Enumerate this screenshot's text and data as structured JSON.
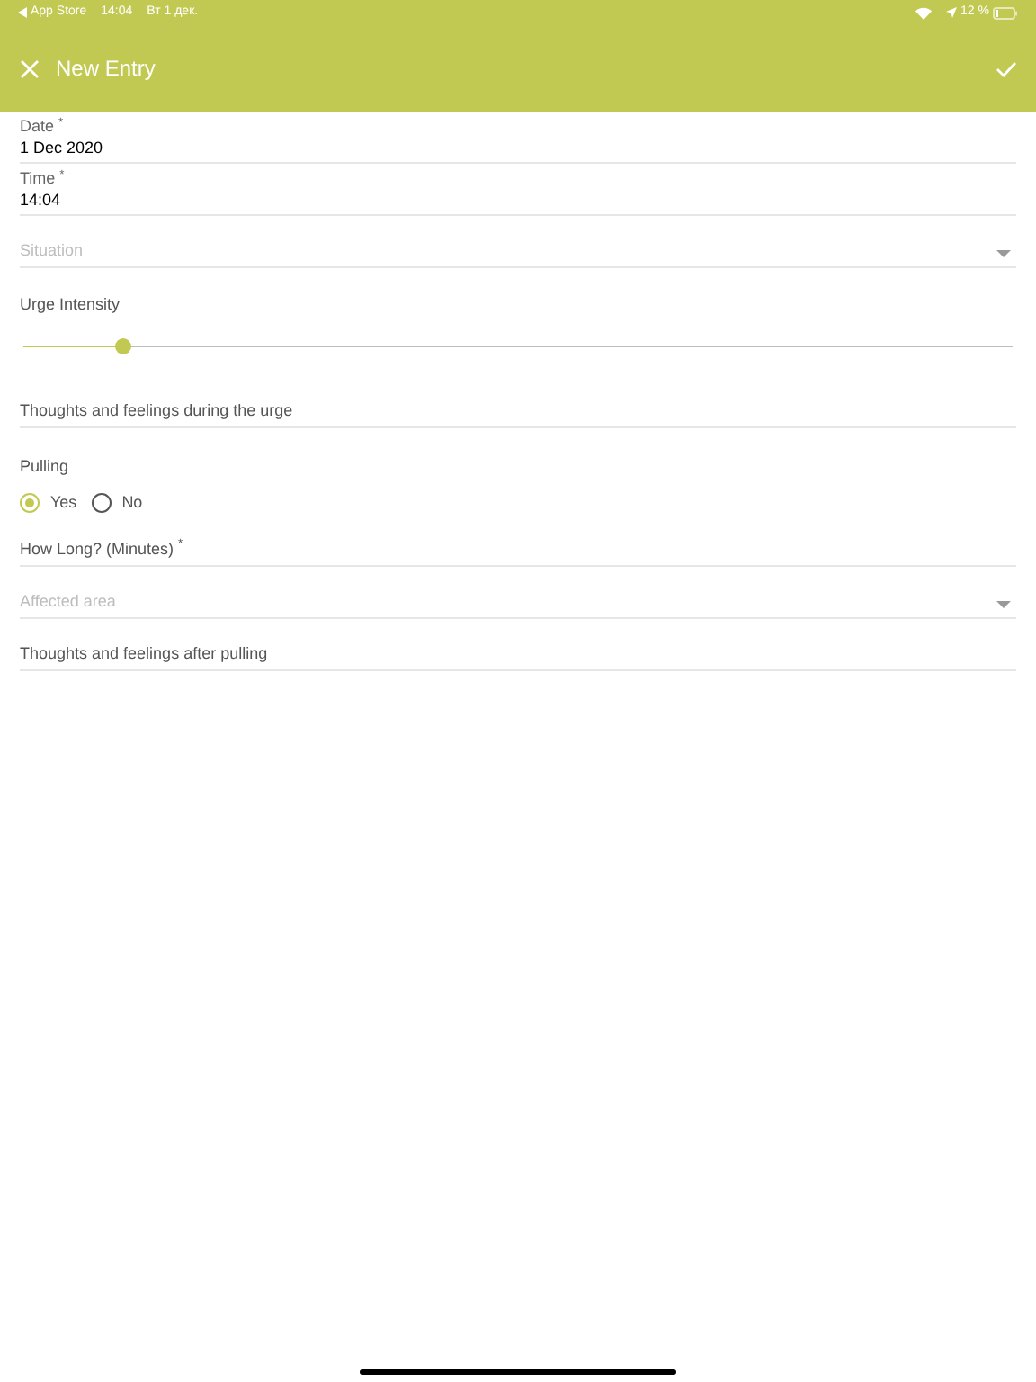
{
  "status_bar": {
    "back_label": "App Store",
    "time": "14:04",
    "date": "Вт 1 дек.",
    "battery": "12 %"
  },
  "header": {
    "title": "New Entry"
  },
  "fields": [
    {
      "kind": "value",
      "label": "Date $^{*}$",
      "value": "1 Dec 2020"
    },
    {
      "kind": "value",
      "label": "Time $^{*}$",
      "value": "14:04"
    },
    {
      "kind": "select",
      "placeholder": "Situation"
    },
    {
      "kind": "slider",
      "label": "Urge Intensity",
      "level": 0.1
    },
    {
      "kind": "text",
      "placeholder": "Thoughts and feelings during the urge"
    },
    {
      "kind": "radio",
      "label": "Pulling",
      "options": [
        {
          "label": "Yes",
          "selected": true
        },
        {
          "label": "No",
          "selected": false
        }
      ]
    },
    {
      "kind": "text",
      "placeholder": "How Long? (Minutes) $^{*}$"
    },
    {
      "kind": "select",
      "placeholder": "Affected area"
    },
    {
      "kind": "text",
      "placeholder": "Thoughts and feelings after pulling"
    }
  ]
}
